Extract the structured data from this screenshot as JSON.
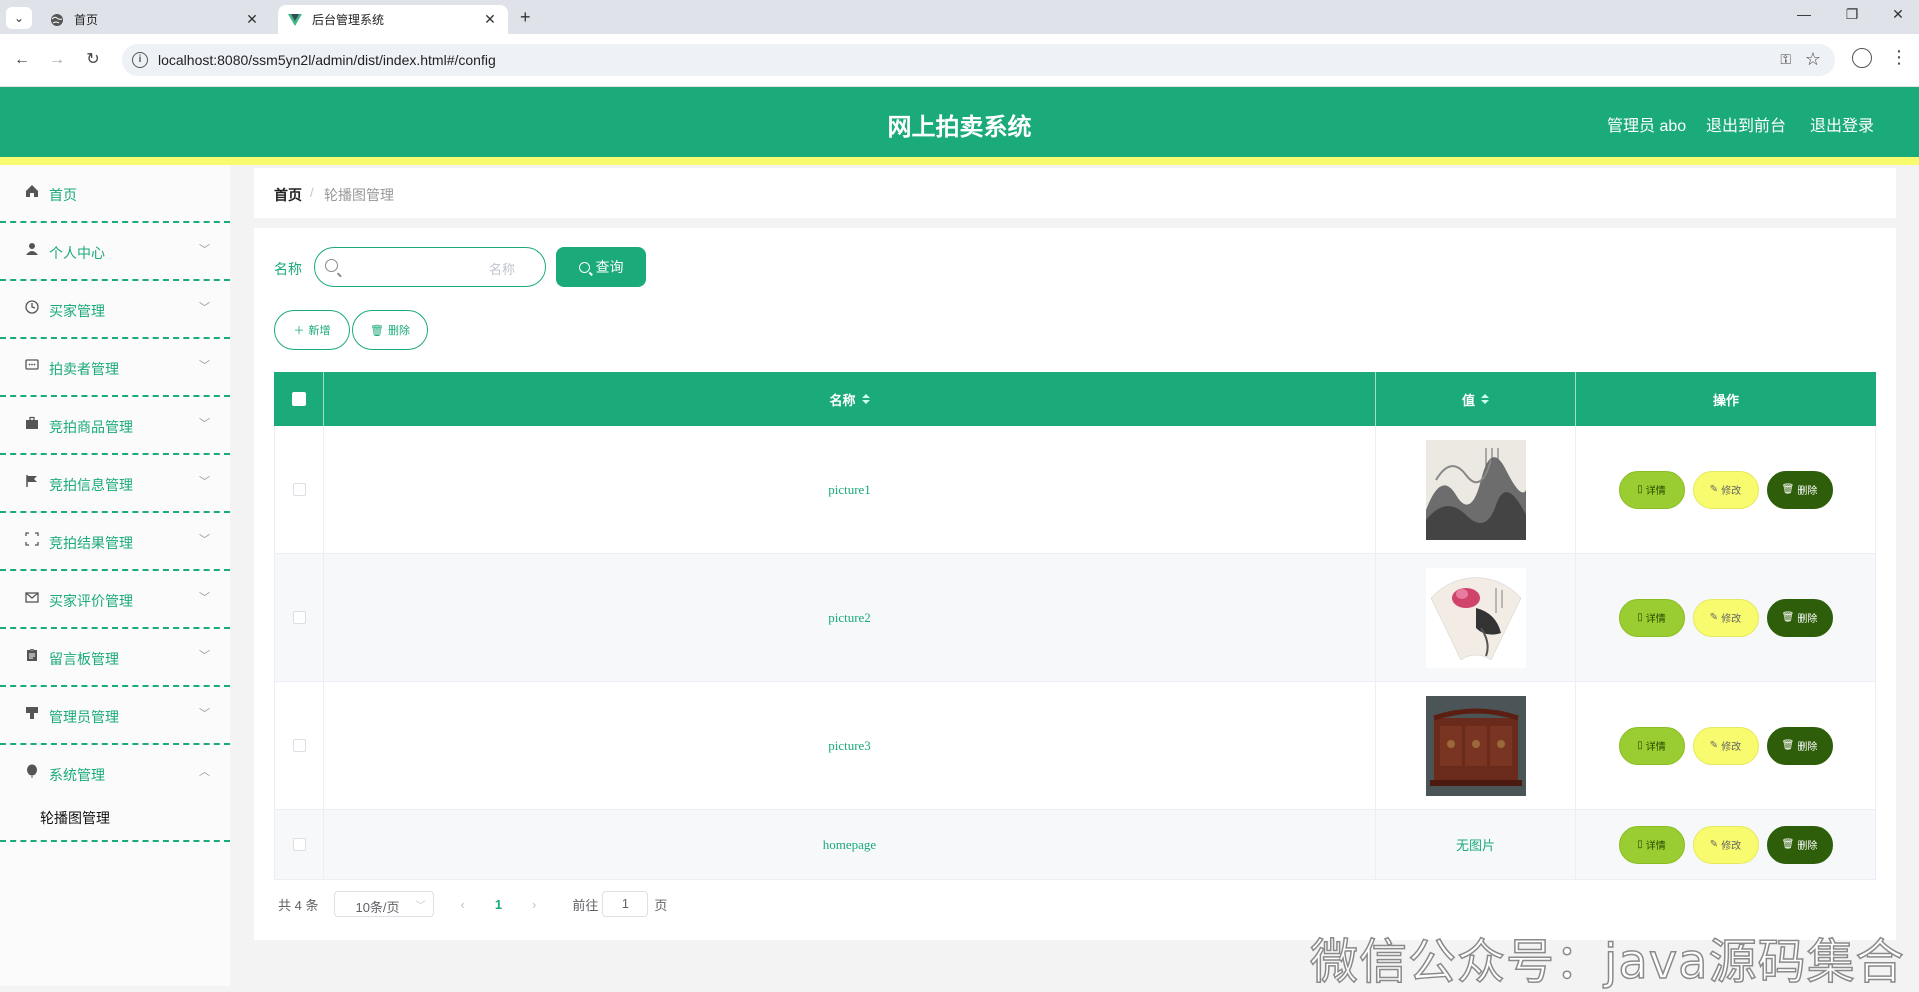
{
  "browser": {
    "tabs": [
      {
        "title": "首页",
        "favicon": "globe-icon",
        "active": false
      },
      {
        "title": "后台管理系统",
        "favicon": "vue-icon",
        "active": true
      }
    ],
    "url": "localhost:8080/ssm5yn2l/admin/dist/index.html#/config"
  },
  "header": {
    "title": "网上拍卖系统",
    "admin_label": "管理员 abo",
    "to_front": "退出到前台",
    "logout": "退出登录"
  },
  "sidebar": {
    "items": [
      {
        "label": "首页",
        "icon": "home-icon",
        "expandable": false
      },
      {
        "label": "个人中心",
        "icon": "user-icon",
        "expandable": true
      },
      {
        "label": "买家管理",
        "icon": "clock-icon",
        "expandable": true
      },
      {
        "label": "拍卖者管理",
        "icon": "chat-icon",
        "expandable": true
      },
      {
        "label": "竞拍商品管理",
        "icon": "briefcase-icon",
        "expandable": true
      },
      {
        "label": "竞拍信息管理",
        "icon": "flag-icon",
        "expandable": true
      },
      {
        "label": "竞拍结果管理",
        "icon": "fullscreen-icon",
        "expandable": true
      },
      {
        "label": "买家评价管理",
        "icon": "mail-icon",
        "expandable": true
      },
      {
        "label": "留言板管理",
        "icon": "clipboard-icon",
        "expandable": true
      },
      {
        "label": "管理员管理",
        "icon": "brush-icon",
        "expandable": true
      },
      {
        "label": "系统管理",
        "icon": "balloon-icon",
        "expandable": true,
        "expanded": true
      }
    ],
    "sub_item": "轮播图管理"
  },
  "breadcrumb": {
    "home": "首页",
    "separator": "/",
    "current": "轮播图管理"
  },
  "search": {
    "label": "名称",
    "placeholder": "名称",
    "query_button": "查询"
  },
  "actions": {
    "add": "新增",
    "delete": "删除"
  },
  "table": {
    "columns": [
      "名称",
      "值",
      "操作"
    ],
    "rows": [
      {
        "name": "picture1",
        "value_type": "image",
        "image_desc": "ink landscape painting"
      },
      {
        "name": "picture2",
        "value_type": "image",
        "image_desc": "fan painting with lotus"
      },
      {
        "name": "picture3",
        "value_type": "image",
        "image_desc": "carved wooden screen"
      },
      {
        "name": "homepage",
        "value_type": "text",
        "value_text": "无图片"
      }
    ],
    "row_buttons": {
      "detail": "详情",
      "edit": "修改",
      "delete": "删除"
    }
  },
  "pagination": {
    "total": "共 4 条",
    "page_size": "10条/页",
    "current_page": "1",
    "goto_label": "前往",
    "goto_value": "1",
    "page_suffix": "页"
  },
  "watermark": "微信公众号：java源码集合",
  "colors": {
    "primary": "#1baa7a",
    "accent_yellow": "#f8fb6e",
    "detail_green": "#9acd32",
    "delete_dark": "#2f5e0a"
  }
}
